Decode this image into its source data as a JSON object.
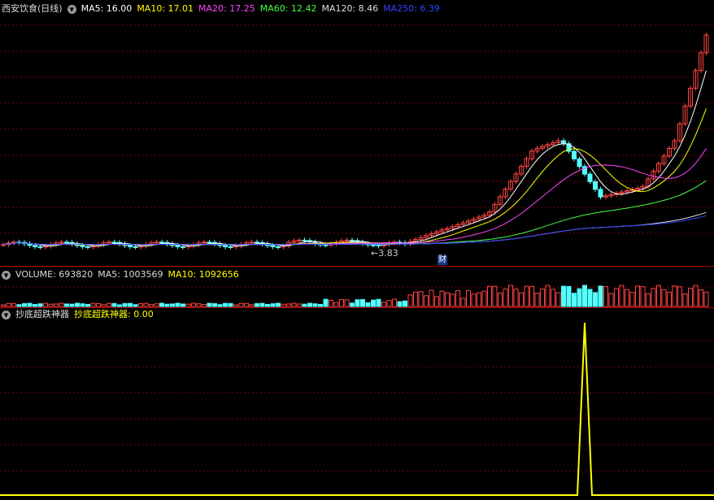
{
  "colors": {
    "background": "#000000",
    "grid": "#7a0000",
    "up": "#ff4444",
    "down": "#54ffff",
    "ma5": "#ffffff",
    "ma10": "#ffff00",
    "ma20": "#ff44ff",
    "ma60": "#44ff44",
    "ma120": "#dddddd",
    "ma250": "#3344ff",
    "signal": "#ffff00"
  },
  "price_panel": {
    "title": "西安饮食(日线)",
    "menu_icon": "chevron-down-icon",
    "ma5_label": "MA5: 16.00",
    "ma10_label": "MA10: 17.01",
    "ma20_label": "MA20: 17.25",
    "ma60_label": "MA60: 12.42",
    "ma120_label": "MA120: 8.46",
    "ma250_label": "MA250: 6.39",
    "low_marker": "←3.83",
    "event_marker": "财"
  },
  "volume_panel": {
    "title": "VOLUME: 693820",
    "ma5_label": "MA5: 1003569",
    "ma10_label": "MA10: 1092656"
  },
  "indicator_panel": {
    "name": "抄底超跌神器",
    "value_label": "抄底超跌神器: 0.00"
  }
}
